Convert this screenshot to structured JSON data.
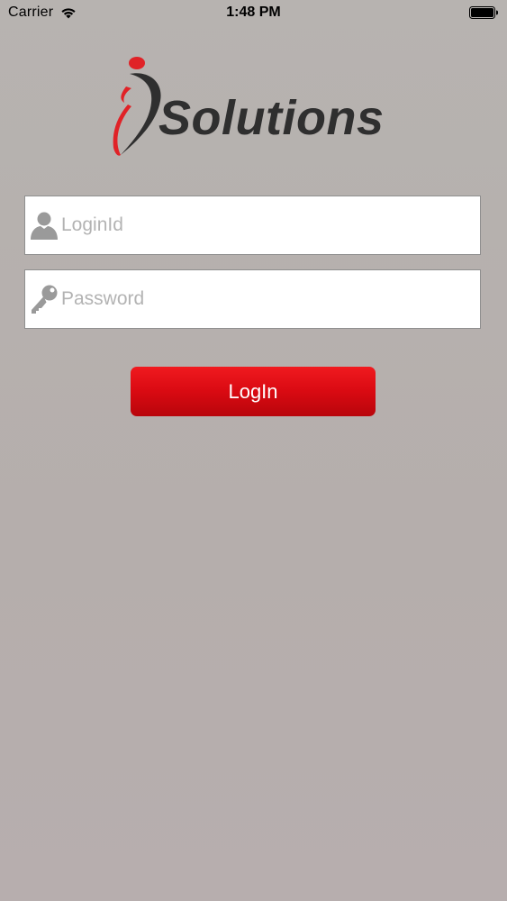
{
  "status_bar": {
    "carrier": "Carrier",
    "time": "1:48 PM",
    "wifi_icon": "wifi-icon",
    "battery_icon": "battery-icon"
  },
  "logo": {
    "text": "Solutions",
    "colors": {
      "text": "#2f2f2f",
      "accent": "#e02227"
    }
  },
  "form": {
    "login_id": {
      "icon": "user-icon",
      "placeholder": "LoginId",
      "value": ""
    },
    "password": {
      "icon": "key-icon",
      "placeholder": "Password",
      "value": ""
    },
    "submit": {
      "label": "LogIn",
      "color": "#d90a12"
    }
  },
  "theme": {
    "background": "#b6b0ae"
  }
}
